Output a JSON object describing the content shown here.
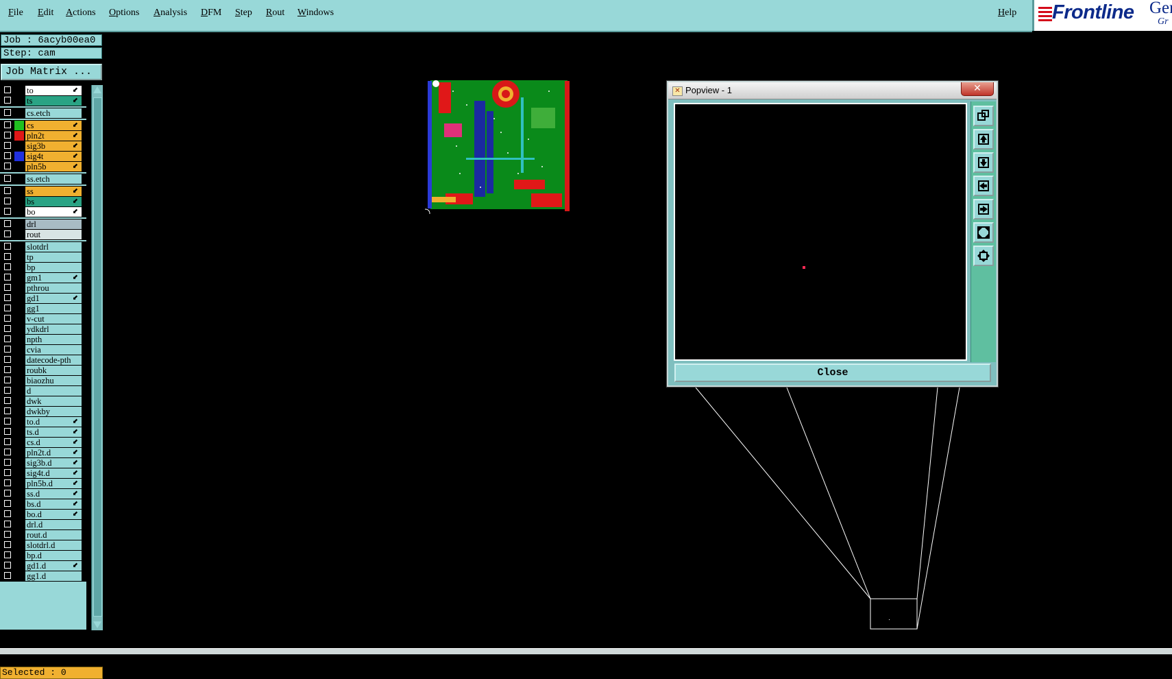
{
  "menu": {
    "file": "File",
    "edit": "Edit",
    "actions": "Actions",
    "options": "Options",
    "analysis": "Analysis",
    "dfm": "DFM",
    "step": "Step",
    "rout": "Rout",
    "windows": "Windows",
    "help": "Help"
  },
  "logo": {
    "brand": "Frontline",
    "product_fragment": "Ger",
    "sub_fragment": "Gr",
    "brand_color": "#0c2a8a",
    "accent_color": "#d40a1a"
  },
  "job": {
    "job_label": "Job : 6acyb00ea0",
    "step_label": "Step: cam",
    "job_matrix_label": "Job Matrix ..."
  },
  "layers": [
    {
      "name": "to",
      "bg": "#ffffff",
      "swatch": "",
      "arrow": "⬋"
    },
    {
      "name": "ts",
      "bg": "#2aa384",
      "swatch": "",
      "arrow": "⬋"
    },
    {
      "name": "cs.etch",
      "bg": "#98d8d8",
      "swatch": "",
      "arrow": ""
    },
    {
      "name": "cs",
      "bg": "#f0b030",
      "swatch": "#20c020",
      "arrow": "⬋"
    },
    {
      "name": "pln2t",
      "bg": "#f0b030",
      "swatch": "#e01818",
      "arrow": "⬋"
    },
    {
      "name": "sig3b",
      "bg": "#f0b030",
      "swatch": "",
      "arrow": "⬋"
    },
    {
      "name": "sig4t",
      "bg": "#f0b030",
      "swatch": "#2030e0",
      "arrow": "⬋"
    },
    {
      "name": "pln5b",
      "bg": "#f0b030",
      "swatch": "",
      "arrow": "⬋"
    },
    {
      "name": "ss.etch",
      "bg": "#98d8d8",
      "swatch": "",
      "arrow": ""
    },
    {
      "name": "ss",
      "bg": "#f0b030",
      "swatch": "",
      "arrow": "⬋"
    },
    {
      "name": "bs",
      "bg": "#2aa384",
      "swatch": "",
      "arrow": "⬋"
    },
    {
      "name": "bo",
      "bg": "#ffffff",
      "swatch": "",
      "arrow": "⬋"
    },
    {
      "name": "drl",
      "bg": "#a8bcc4",
      "swatch": "",
      "arrow": ""
    },
    {
      "name": "rout",
      "bg": "#d8e4e4",
      "swatch": "",
      "arrow": ""
    },
    {
      "name": "slotdrl",
      "bg": "#98d8d8",
      "swatch": "",
      "arrow": ""
    },
    {
      "name": "tp",
      "bg": "#98d8d8",
      "swatch": "",
      "arrow": ""
    },
    {
      "name": "bp",
      "bg": "#98d8d8",
      "swatch": "",
      "arrow": ""
    },
    {
      "name": "gm1",
      "bg": "#98d8d8",
      "swatch": "",
      "arrow": "⬋"
    },
    {
      "name": "pthrou",
      "bg": "#98d8d8",
      "swatch": "",
      "arrow": ""
    },
    {
      "name": "gd1",
      "bg": "#98d8d8",
      "swatch": "",
      "arrow": "⬋"
    },
    {
      "name": "gg1",
      "bg": "#98d8d8",
      "swatch": "",
      "arrow": ""
    },
    {
      "name": "v-cut",
      "bg": "#98d8d8",
      "swatch": "",
      "arrow": ""
    },
    {
      "name": "ydkdrl",
      "bg": "#98d8d8",
      "swatch": "",
      "arrow": ""
    },
    {
      "name": "npth",
      "bg": "#98d8d8",
      "swatch": "",
      "arrow": ""
    },
    {
      "name": "cvia",
      "bg": "#98d8d8",
      "swatch": "",
      "arrow": ""
    },
    {
      "name": "datecode-pth",
      "bg": "#98d8d8",
      "swatch": "",
      "arrow": ""
    },
    {
      "name": "roubk",
      "bg": "#98d8d8",
      "swatch": "",
      "arrow": ""
    },
    {
      "name": "biaozhu",
      "bg": "#98d8d8",
      "swatch": "",
      "arrow": ""
    },
    {
      "name": "d",
      "bg": "#98d8d8",
      "swatch": "",
      "arrow": ""
    },
    {
      "name": "dwk",
      "bg": "#98d8d8",
      "swatch": "",
      "arrow": ""
    },
    {
      "name": "dwkby",
      "bg": "#98d8d8",
      "swatch": "",
      "arrow": ""
    },
    {
      "name": "to.d",
      "bg": "#98d8d8",
      "swatch": "",
      "arrow": "⬋"
    },
    {
      "name": "ts.d",
      "bg": "#98d8d8",
      "swatch": "",
      "arrow": "⬋"
    },
    {
      "name": "cs.d",
      "bg": "#98d8d8",
      "swatch": "",
      "arrow": "⬋"
    },
    {
      "name": "pln2t.d",
      "bg": "#98d8d8",
      "swatch": "",
      "arrow": "⬋"
    },
    {
      "name": "sig3b.d",
      "bg": "#98d8d8",
      "swatch": "",
      "arrow": "⬋"
    },
    {
      "name": "sig4t.d",
      "bg": "#98d8d8",
      "swatch": "",
      "arrow": "⬋"
    },
    {
      "name": "pln5b.d",
      "bg": "#98d8d8",
      "swatch": "",
      "arrow": "⬋"
    },
    {
      "name": "ss.d",
      "bg": "#98d8d8",
      "swatch": "",
      "arrow": "⬋"
    },
    {
      "name": "bs.d",
      "bg": "#98d8d8",
      "swatch": "",
      "arrow": "⬋"
    },
    {
      "name": "bo.d",
      "bg": "#98d8d8",
      "swatch": "",
      "arrow": "⬋"
    },
    {
      "name": "drl.d",
      "bg": "#98d8d8",
      "swatch": "",
      "arrow": ""
    },
    {
      "name": "rout.d",
      "bg": "#98d8d8",
      "swatch": "",
      "arrow": ""
    },
    {
      "name": "slotdrl.d",
      "bg": "#98d8d8",
      "swatch": "",
      "arrow": ""
    },
    {
      "name": "bp.d",
      "bg": "#98d8d8",
      "swatch": "",
      "arrow": ""
    },
    {
      "name": "gd1.d",
      "bg": "#98d8d8",
      "swatch": "",
      "arrow": "⬋"
    },
    {
      "name": "gg1.d",
      "bg": "#98d8d8",
      "swatch": "",
      "arrow": ""
    }
  ],
  "status": {
    "selected_label": "Selected : 0"
  },
  "popview": {
    "title": "Popview - 1",
    "close_label": "Close",
    "close_x": "✕",
    "tools": [
      "zoom-window-icon",
      "pan-up-icon",
      "pan-down-icon",
      "pan-left-icon",
      "pan-right-icon",
      "zoom-home-icon",
      "zoom-fit-icon"
    ]
  }
}
